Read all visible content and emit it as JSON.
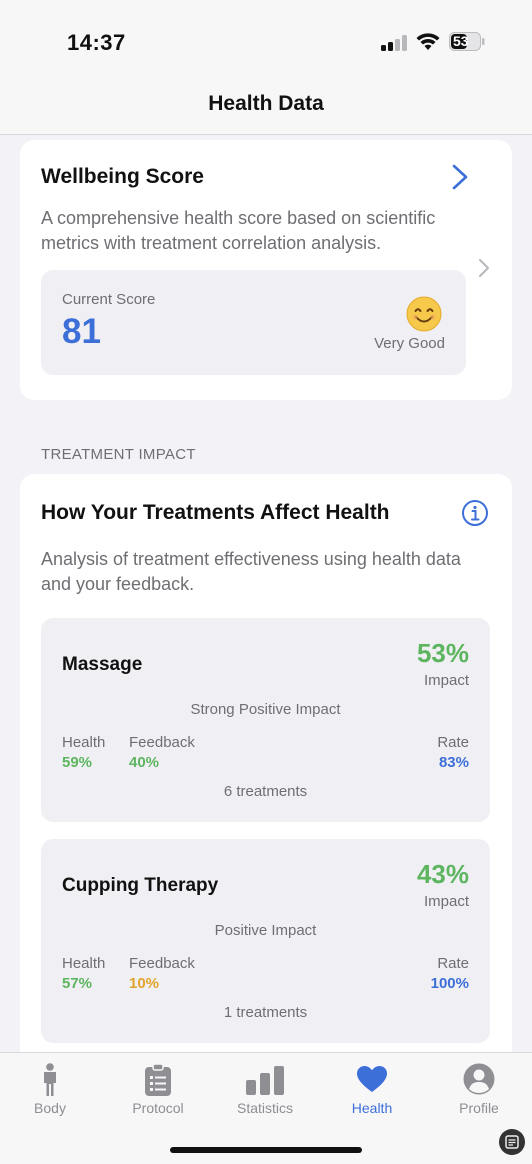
{
  "status_bar": {
    "time": "14:37",
    "battery": "53"
  },
  "nav": {
    "title": "Health Data"
  },
  "wellbeing": {
    "title": "Wellbeing Score",
    "description": "A comprehensive health score based on scientific metrics with treatment correlation analysis.",
    "score_label": "Current Score",
    "score": "81",
    "score_status": "Very Good",
    "emoji": "smiling-face-emoji"
  },
  "section_header": "TREATMENT IMPACT",
  "treatment_impact": {
    "title": "How Your Treatments Affect Health",
    "description": "Analysis of treatment effectiveness using health data and your feedback.",
    "treatments": [
      {
        "name": "Massage",
        "impact_pct": "53%",
        "impact_label": "Impact",
        "status": "Strong Positive Impact",
        "health_label": "Health",
        "health": "59%",
        "feedback_label": "Feedback",
        "feedback": "40%",
        "rate_label": "Rate",
        "rate": "83%",
        "count": "6 treatments"
      },
      {
        "name": "Cupping Therapy",
        "impact_pct": "43%",
        "impact_label": "Impact",
        "status": "Positive Impact",
        "health_label": "Health",
        "health": "57%",
        "feedback_label": "Feedback",
        "feedback": "10%",
        "rate_label": "Rate",
        "rate": "100%",
        "count": "1 treatments"
      }
    ]
  },
  "tabs": [
    {
      "label": "Body",
      "icon": "person-icon"
    },
    {
      "label": "Protocol",
      "icon": "clipboard-icon"
    },
    {
      "label": "Statistics",
      "icon": "bar-chart-icon"
    },
    {
      "label": "Health",
      "icon": "heart-icon",
      "active": true
    },
    {
      "label": "Profile",
      "icon": "profile-icon"
    }
  ],
  "colors": {
    "accent": "#3d6fd9",
    "positive": "#5db55f",
    "warning": "#e2a32a",
    "background": "#f2f2f7"
  }
}
